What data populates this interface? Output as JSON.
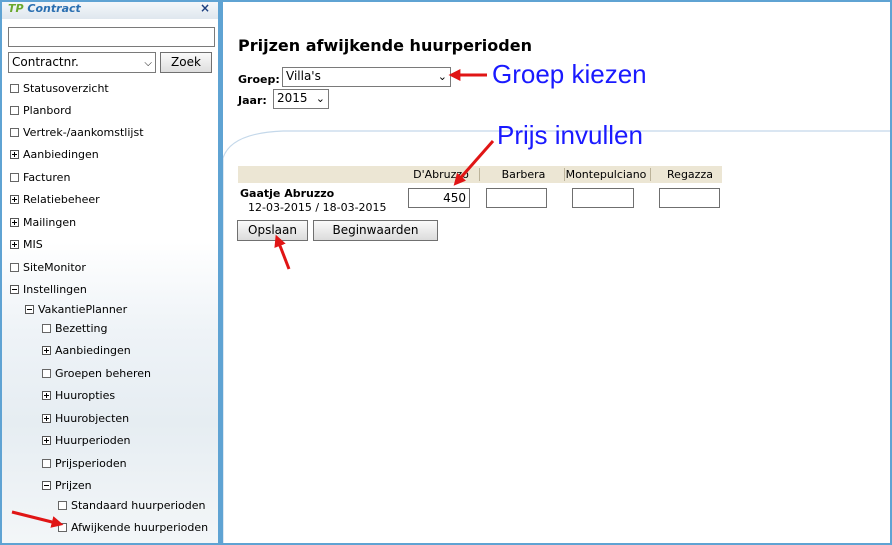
{
  "sidebar": {
    "logo_tp": "TP",
    "logo_contract": "Contract",
    "close": "×",
    "search": {
      "value": "",
      "placeholder": ""
    },
    "select_value": "Contractnr.",
    "zoek_label": "Zoek",
    "items": [
      {
        "label": "Statusoverzicht",
        "icon": "collapsed-box"
      },
      {
        "label": "Planbord",
        "icon": "collapsed-box"
      },
      {
        "label": "Vertrek-/aankomstlijst",
        "icon": "collapsed-box"
      },
      {
        "label": "Aanbiedingen",
        "icon": "plus-box"
      },
      {
        "label": "Facturen",
        "icon": "collapsed-box"
      },
      {
        "label": "Relatiebeheer",
        "icon": "plus-box"
      },
      {
        "label": "Mailingen",
        "icon": "plus-box"
      },
      {
        "label": "MIS",
        "icon": "plus-box"
      },
      {
        "label": "SiteMonitor",
        "icon": "collapsed-box"
      },
      {
        "label": "Instellingen",
        "icon": "minus-box"
      },
      {
        "label": "VakantiePlanner",
        "icon": "minus-box"
      },
      {
        "label": "Bezetting",
        "icon": "collapsed-box"
      },
      {
        "label": "Aanbiedingen",
        "icon": "plus-box"
      },
      {
        "label": "Groepen beheren",
        "icon": "collapsed-box"
      },
      {
        "label": "Huuropties",
        "icon": "plus-box"
      },
      {
        "label": "Huurobjecten",
        "icon": "plus-box"
      },
      {
        "label": "Huurperioden",
        "icon": "plus-box"
      },
      {
        "label": "Prijsperioden",
        "icon": "collapsed-box"
      },
      {
        "label": "Prijzen",
        "icon": "minus-box"
      },
      {
        "label": "Standaard huurperioden",
        "icon": "collapsed-box"
      },
      {
        "label": "Afwijkende huurperioden",
        "icon": "collapsed-box"
      }
    ]
  },
  "main": {
    "title": "Prijzen afwijkende huurperioden",
    "groep_label": "Groep:",
    "groep_value": "Villa's",
    "jaar_label": "Jaar:",
    "jaar_value": "2015",
    "table": {
      "columns": [
        "D'Abruzzo",
        "Barbera",
        "Montepulciano",
        "Regazza"
      ],
      "row_name": "Gaatje Abruzzo",
      "row_dates": "12-03-2015 / 18-03-2015",
      "values": [
        "450",
        "",
        "",
        ""
      ]
    },
    "save_label": "Opslaan",
    "reset_label": "Beginwaarden"
  },
  "annotations": {
    "groep_kiezen": "Groep kiezen",
    "prijs_invullen": "Prijs invullen"
  },
  "colors": {
    "frame": "#5fa3d3",
    "annotation_text": "#1a1aff",
    "annotation_arrow": "#e01515",
    "table_header": "#ece6d4"
  }
}
